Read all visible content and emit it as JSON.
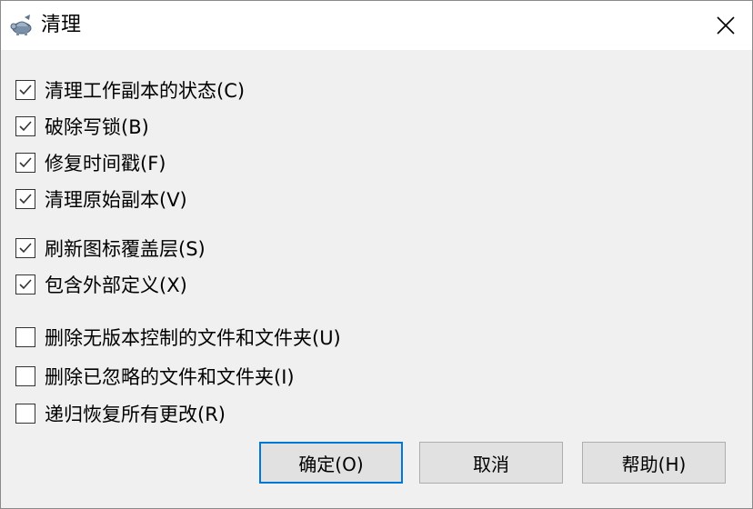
{
  "window": {
    "title": "清理",
    "app_icon": "tortoise-icon",
    "close_icon": "close-icon"
  },
  "options": [
    {
      "label": "清理工作副本的状态(C)",
      "checked": true
    },
    {
      "label": "破除写锁(B)",
      "checked": true
    },
    {
      "label": "修复时间戳(F)",
      "checked": true
    },
    {
      "label": "清理原始副本(V)",
      "checked": true
    },
    {
      "label": "刷新图标覆盖层(S)",
      "checked": true
    },
    {
      "label": "包含外部定义(X)",
      "checked": true
    },
    {
      "label": "删除无版本控制的文件和文件夹(U)",
      "checked": false
    },
    {
      "label": "删除已忽略的文件和文件夹(I)",
      "checked": false
    },
    {
      "label": "递归恢复所有更改(R)",
      "checked": false
    }
  ],
  "buttons": {
    "ok": "确定(O)",
    "cancel": "取消",
    "help": "帮助(H)"
  },
  "colors": {
    "focus_border": "#0078d7",
    "button_bg": "#e1e1e1",
    "dialog_bg": "#f0f0f0"
  }
}
